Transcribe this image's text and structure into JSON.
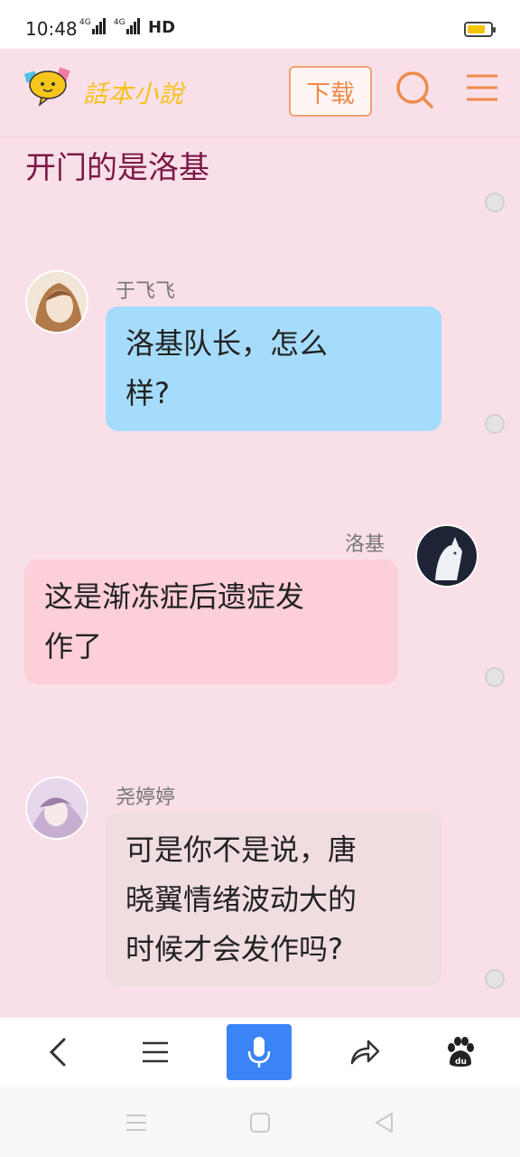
{
  "status_bar": {
    "time": "10:48",
    "network_1": "4G",
    "network_2": "4G",
    "hd": "HD",
    "battery_level": 0.8,
    "battery_color": "#f3c400"
  },
  "header": {
    "logo_text": "話本小說",
    "logo_icon": "speech-bubble-logo-icon",
    "download_label": "下载",
    "search_icon": "search-icon",
    "menu_icon": "hamburger-menu-icon",
    "accent_color": "#ee8b4a"
  },
  "chapter": {
    "title": "开门的是洛基"
  },
  "messages": [
    {
      "speaker": "于飞飞",
      "side": "left",
      "text": "洛基队长，怎么样?",
      "line1": "洛基队长，怎么",
      "line2": "样?",
      "bubble_color": "#a6dcfb"
    },
    {
      "speaker": "洛基",
      "side": "right",
      "text": "这是渐冻症后遗症发作了",
      "line1": "这是渐冻症后遗症发",
      "line2": "作了",
      "bubble_color": "#fdcfd9"
    },
    {
      "speaker": "尧婷婷",
      "side": "left",
      "text": "可是你不是说，唐晓翼情绪波动大的时候才会发作吗?",
      "line1": "可是你不是说，唐",
      "line2": "晓翼情绪波动大的",
      "line3": "时候才会发作吗?",
      "bubble_color": "#f0dde0"
    }
  ],
  "toolbar": {
    "back_icon": "back-arrow-icon",
    "menu_icon": "list-menu-icon",
    "mic_icon": "microphone-icon",
    "share_icon": "share-icon",
    "baidu_icon": "baidu-paw-icon",
    "mic_color": "#3a84f6"
  },
  "navbar": {
    "recent_icon": "recents-icon",
    "home_icon": "home-icon",
    "back_icon": "back-triangle-icon"
  }
}
